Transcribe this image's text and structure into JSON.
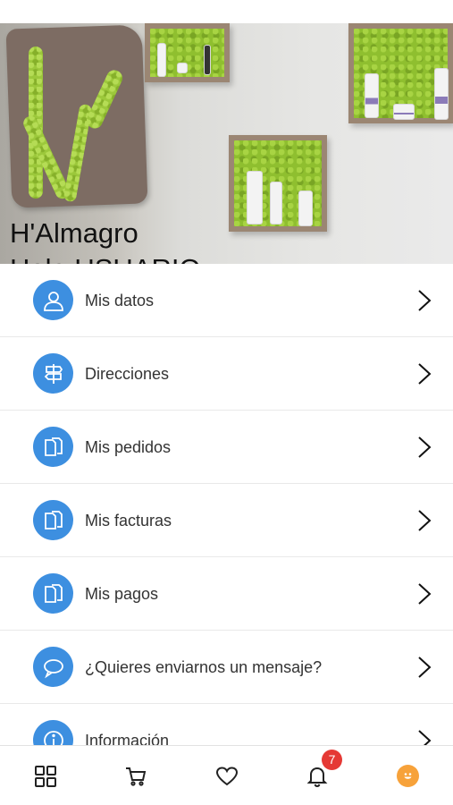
{
  "hero": {
    "business_name": "H'Almagro",
    "greeting": "Hola USUARIO"
  },
  "menu": {
    "items": [
      {
        "label": "Mis datos",
        "icon": "user-icon"
      },
      {
        "label": "Direcciones",
        "icon": "signpost-icon"
      },
      {
        "label": "Mis pedidos",
        "icon": "documents-icon"
      },
      {
        "label": "Mis facturas",
        "icon": "documents-icon"
      },
      {
        "label": "Mis pagos",
        "icon": "documents-icon"
      },
      {
        "label": "¿Quieres enviarnos un mensaje?",
        "icon": "chat-bubble-icon"
      },
      {
        "label": "Información",
        "icon": "info-icon"
      }
    ]
  },
  "tabbar": {
    "items": [
      {
        "icon": "grid-icon"
      },
      {
        "icon": "cart-icon"
      },
      {
        "icon": "heart-icon"
      },
      {
        "icon": "bell-icon"
      },
      {
        "icon": "profile-icon"
      }
    ],
    "notifications_count": "7"
  },
  "colors": {
    "accent": "#3d8fe0",
    "badge": "#e53935",
    "profile": "#f7a23a"
  }
}
